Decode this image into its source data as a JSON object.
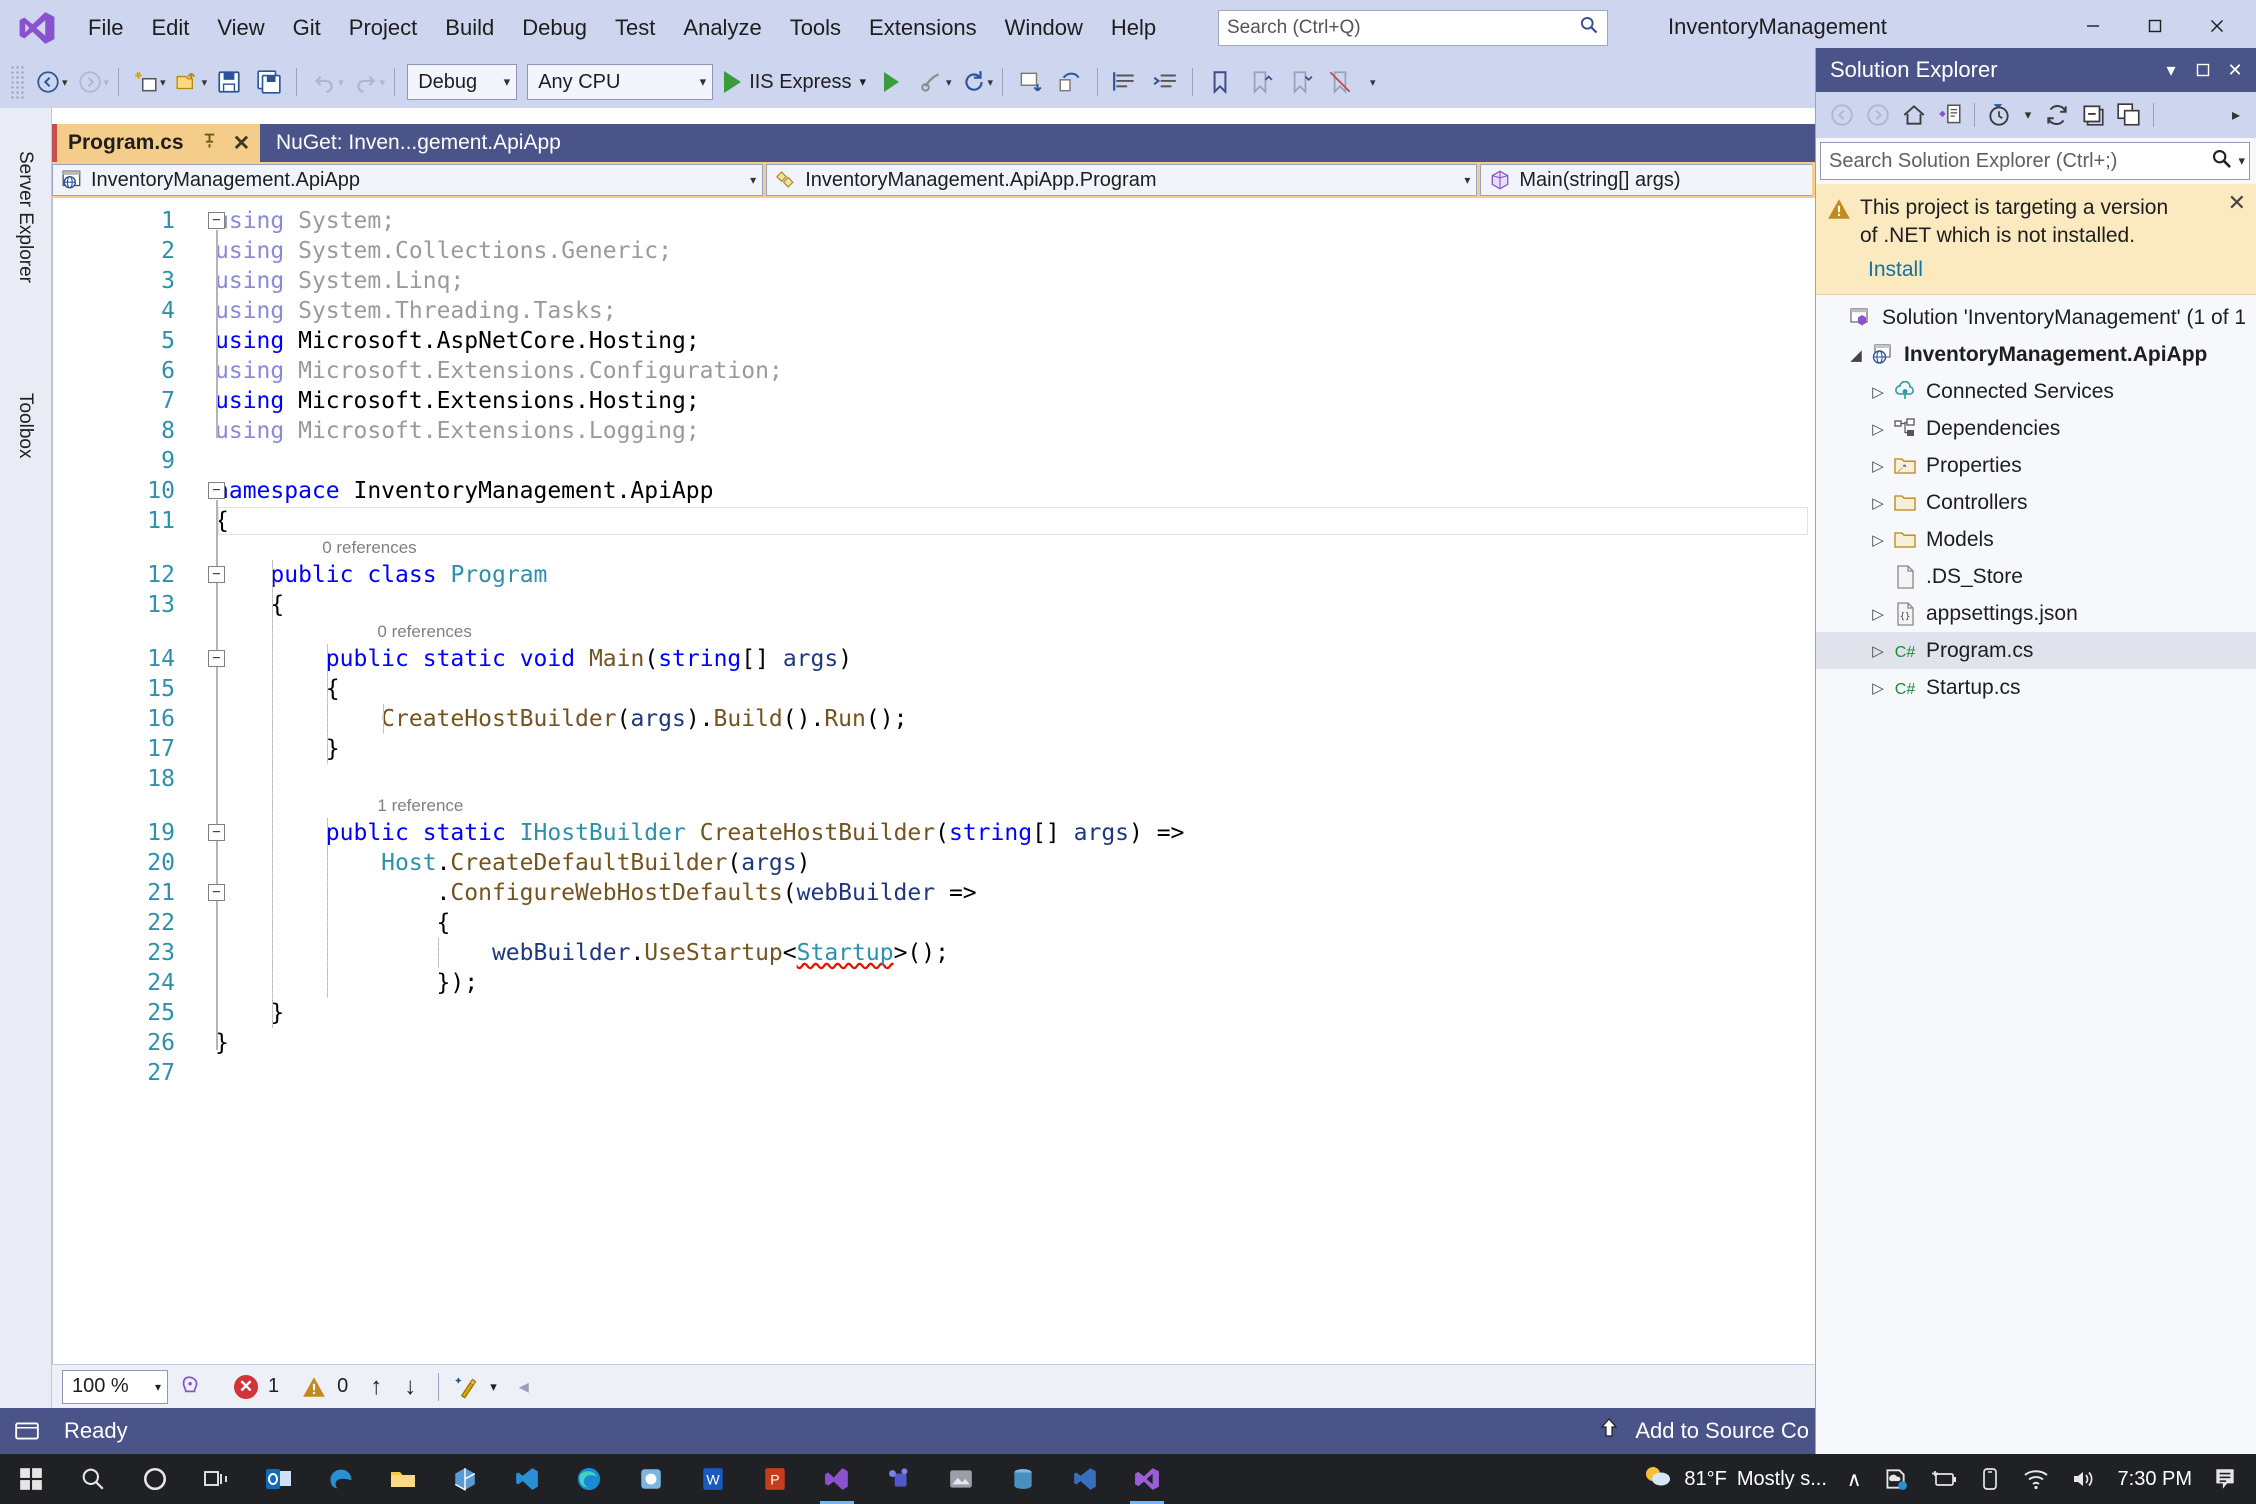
{
  "window": {
    "title": "InventoryManagement",
    "minimize": "—",
    "maximize": "☐",
    "close": "✕"
  },
  "menubar": {
    "logo": "visual-studio-logo",
    "items": [
      "File",
      "Edit",
      "View",
      "Git",
      "Project",
      "Build",
      "Debug",
      "Test",
      "Analyze",
      "Tools",
      "Extensions",
      "Window",
      "Help"
    ]
  },
  "search": {
    "placeholder": "Search (Ctrl+Q)",
    "value": "Search (Ctrl+Q)",
    "icon": "search-icon"
  },
  "toolbar": {
    "configuration": "Debug",
    "platform": "Any CPU",
    "run_target": "IIS Express",
    "icons": [
      "navigate-backward-icon",
      "navigate-forward-icon",
      "new-project-icon",
      "open-file-icon",
      "save-icon",
      "save-all-icon",
      "undo-icon",
      "redo-icon",
      "start-debug-icon",
      "attach-process-icon",
      "refresh-icon",
      "step-into-icon",
      "step-over-icon",
      "step-out-icon",
      "comment-icon",
      "uncomment-icon",
      "bookmark-icon",
      "prev-bookmark-icon",
      "next-bookmark-icon",
      "clear-bookmarks-icon"
    ]
  },
  "leftdock": {
    "tabs": [
      "Server Explorer",
      "Toolbox"
    ]
  },
  "editor_tabs": [
    {
      "label": "Program.cs",
      "active": true,
      "pin": "ᐃ",
      "close": "✕"
    },
    {
      "label": "NuGet: Inven...gement.ApiApp",
      "active": false
    }
  ],
  "navbar": {
    "project": "InventoryManagement.ApiApp",
    "type": "InventoryManagement.ApiApp.Program",
    "member": "Main(string[] args)",
    "arrow": "▾"
  },
  "code": {
    "language": "csharp",
    "lines": [
      {
        "n": 1,
        "text": "using System;",
        "dim": true,
        "fold": "−"
      },
      {
        "n": 2,
        "text": "using System.Collections.Generic;",
        "dim": true
      },
      {
        "n": 3,
        "text": "using System.Linq;",
        "dim": true
      },
      {
        "n": 4,
        "text": "using System.Threading.Tasks;",
        "dim": true
      },
      {
        "n": 5,
        "text": "using Microsoft.AspNetCore.Hosting;",
        "dim": false
      },
      {
        "n": 6,
        "text": "using Microsoft.Extensions.Configuration;",
        "dim": true
      },
      {
        "n": 7,
        "text": "using Microsoft.Extensions.Hosting;",
        "dim": false
      },
      {
        "n": 8,
        "text": "using Microsoft.Extensions.Logging;",
        "dim": true
      },
      {
        "n": 9,
        "text": ""
      },
      {
        "n": 10,
        "text": "namespace InventoryManagement.ApiApp",
        "fold": "−"
      },
      {
        "n": 11,
        "text": "{"
      },
      {
        "n": 12,
        "text": "    public class Program",
        "fold": "−",
        "ref": "0 references"
      },
      {
        "n": 13,
        "text": "    {"
      },
      {
        "n": 14,
        "text": "        public static void Main(string[] args)",
        "fold": "−",
        "ref": "0 references"
      },
      {
        "n": 15,
        "text": "        {"
      },
      {
        "n": 16,
        "text": "            CreateHostBuilder(args).Build().Run();"
      },
      {
        "n": 17,
        "text": "        }"
      },
      {
        "n": 18,
        "text": ""
      },
      {
        "n": 19,
        "text": "        public static IHostBuilder CreateHostBuilder(string[] args) =>",
        "fold": "−",
        "ref": "1 reference"
      },
      {
        "n": 20,
        "text": "            Host.CreateDefaultBuilder(args)"
      },
      {
        "n": 21,
        "text": "                .ConfigureWebHostDefaults(webBuilder =>",
        "fold": "−"
      },
      {
        "n": 22,
        "text": "                {"
      },
      {
        "n": 23,
        "text": "                    webBuilder.UseStartup<Startup>();"
      },
      {
        "n": 24,
        "text": "                });"
      },
      {
        "n": 25,
        "text": "    }"
      },
      {
        "n": 26,
        "text": "}"
      },
      {
        "n": 27,
        "text": ""
      }
    ],
    "error_token": "Startup"
  },
  "editor_bottom": {
    "zoom": "100 %",
    "zoom_arrow": "▾",
    "intellicode_icon": "intellicode-icon",
    "error_count": "1",
    "warning_count": "0",
    "prev_issue": "↑",
    "next_issue": "↓",
    "cleanup_icon": "code-cleanup-icon",
    "cleanup_arrow": "▾",
    "scroll_left": "◂"
  },
  "statusbar": {
    "icon": "source-control-icon",
    "text": "Ready",
    "right_icon": "⬆",
    "right_text": "Add to Source Co"
  },
  "solution_explorer": {
    "title": "Solution Explorer",
    "header_buttons": [
      "▾",
      "☐",
      "✕"
    ],
    "toolbar_icons": [
      "back-icon",
      "forward-icon",
      "home-icon",
      "sync-with-active-document-icon",
      "pending-changes-icon",
      "pending-changes-dropdown-icon",
      "refresh-icon",
      "collapse-all-icon",
      "show-all-files-icon",
      "overflow-icon"
    ],
    "search_placeholder": "Search Solution Explorer (Ctrl+;)",
    "search_icon": "search-icon",
    "search_dropdown": "▾",
    "notice": {
      "icon": "warning-icon",
      "line1": "This project is targeting a version",
      "line2": "of .NET which is not installed.",
      "link": "Install",
      "close": "✕"
    },
    "tree": [
      {
        "label": "Solution 'InventoryManagement' (1 of 1",
        "icon": "solution-icon",
        "indent": 0,
        "expander": "",
        "bold": false
      },
      {
        "label": "InventoryManagement.ApiApp",
        "icon": "web-project-icon",
        "indent": 1,
        "expander": "◢",
        "bold": true
      },
      {
        "label": "Connected Services",
        "icon": "connected-services-icon",
        "indent": 2,
        "expander": "▷",
        "bold": false
      },
      {
        "label": "Dependencies",
        "icon": "dependencies-icon",
        "indent": 2,
        "expander": "▷",
        "bold": false
      },
      {
        "label": "Properties",
        "icon": "properties-folder-icon",
        "indent": 2,
        "expander": "▷",
        "bold": false
      },
      {
        "label": "Controllers",
        "icon": "folder-icon",
        "indent": 2,
        "expander": "▷",
        "bold": false
      },
      {
        "label": "Models",
        "icon": "folder-icon",
        "indent": 2,
        "expander": "▷",
        "bold": false
      },
      {
        "label": ".DS_Store",
        "icon": "file-icon",
        "indent": 2,
        "expander": "",
        "bold": false
      },
      {
        "label": "appsettings.json",
        "icon": "json-file-icon",
        "indent": 2,
        "expander": "▷",
        "bold": false
      },
      {
        "label": "Program.cs",
        "icon": "csharp-file-icon",
        "indent": 2,
        "expander": "▷",
        "bold": false,
        "selected": true
      },
      {
        "label": "Startup.cs",
        "icon": "csharp-file-icon",
        "indent": 2,
        "expander": "▷",
        "bold": false
      }
    ],
    "annotation": {
      "type": "red-up-arrow",
      "color": "#e02020"
    }
  },
  "taskbar": {
    "icons": [
      "windows-start-icon",
      "search-icon",
      "cortana-icon",
      "task-view-icon",
      "outlook-icon",
      "edge-legacy-icon",
      "file-explorer-icon",
      "app-icon",
      "vscode-icon",
      "edge-icon",
      "app2-icon",
      "word-icon",
      "powerpoint-icon",
      "visual-studio-installer-icon",
      "teams-icon",
      "photos-icon",
      "sql-server-icon",
      "azure-data-studio-icon",
      "visual-studio-icon"
    ],
    "tray": {
      "weather_temp": "81°F",
      "weather_desc": "Mostly s...",
      "chevron": "∧",
      "icons": [
        "onedrive-icon",
        "battery-icon",
        "device-icon",
        "wifi-icon",
        "volume-icon"
      ],
      "time": "7:30 PM",
      "notification_icon": "notifications-icon"
    }
  },
  "colors": {
    "accent_chrome": "#cdd5ef",
    "title_dark": "#4a5489",
    "tab_active": "#f5cd8b",
    "notice_bg": "#fbe9c0",
    "error_red": "#d13438",
    "warning_amber": "#c08a1e",
    "keyword_blue": "#0000ff",
    "type_teal": "#2b91af",
    "method_brown": "#74531f",
    "param_navy": "#1f377f",
    "dim_grey": "#9a9a9a",
    "link_blue": "#1570a6"
  }
}
